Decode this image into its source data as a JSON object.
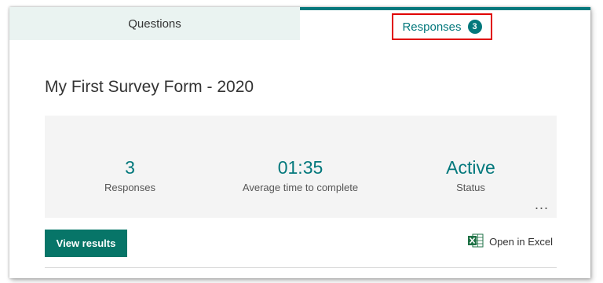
{
  "tabs": {
    "questions": "Questions",
    "responses": "Responses",
    "responses_count": "3"
  },
  "form": {
    "title": "My First Survey Form - 2020"
  },
  "stats": [
    {
      "value": "3",
      "label": "Responses"
    },
    {
      "value": "01:35",
      "label": "Average time to complete"
    },
    {
      "value": "Active",
      "label": "Status"
    }
  ],
  "more_label": "...",
  "actions": {
    "view_results": "View results",
    "open_in_excel": "Open in Excel"
  },
  "colors": {
    "accent": "#03787c",
    "highlight": "#e00000",
    "excel_green": "#1e7145"
  },
  "icons": {
    "excel": "excel-icon"
  }
}
